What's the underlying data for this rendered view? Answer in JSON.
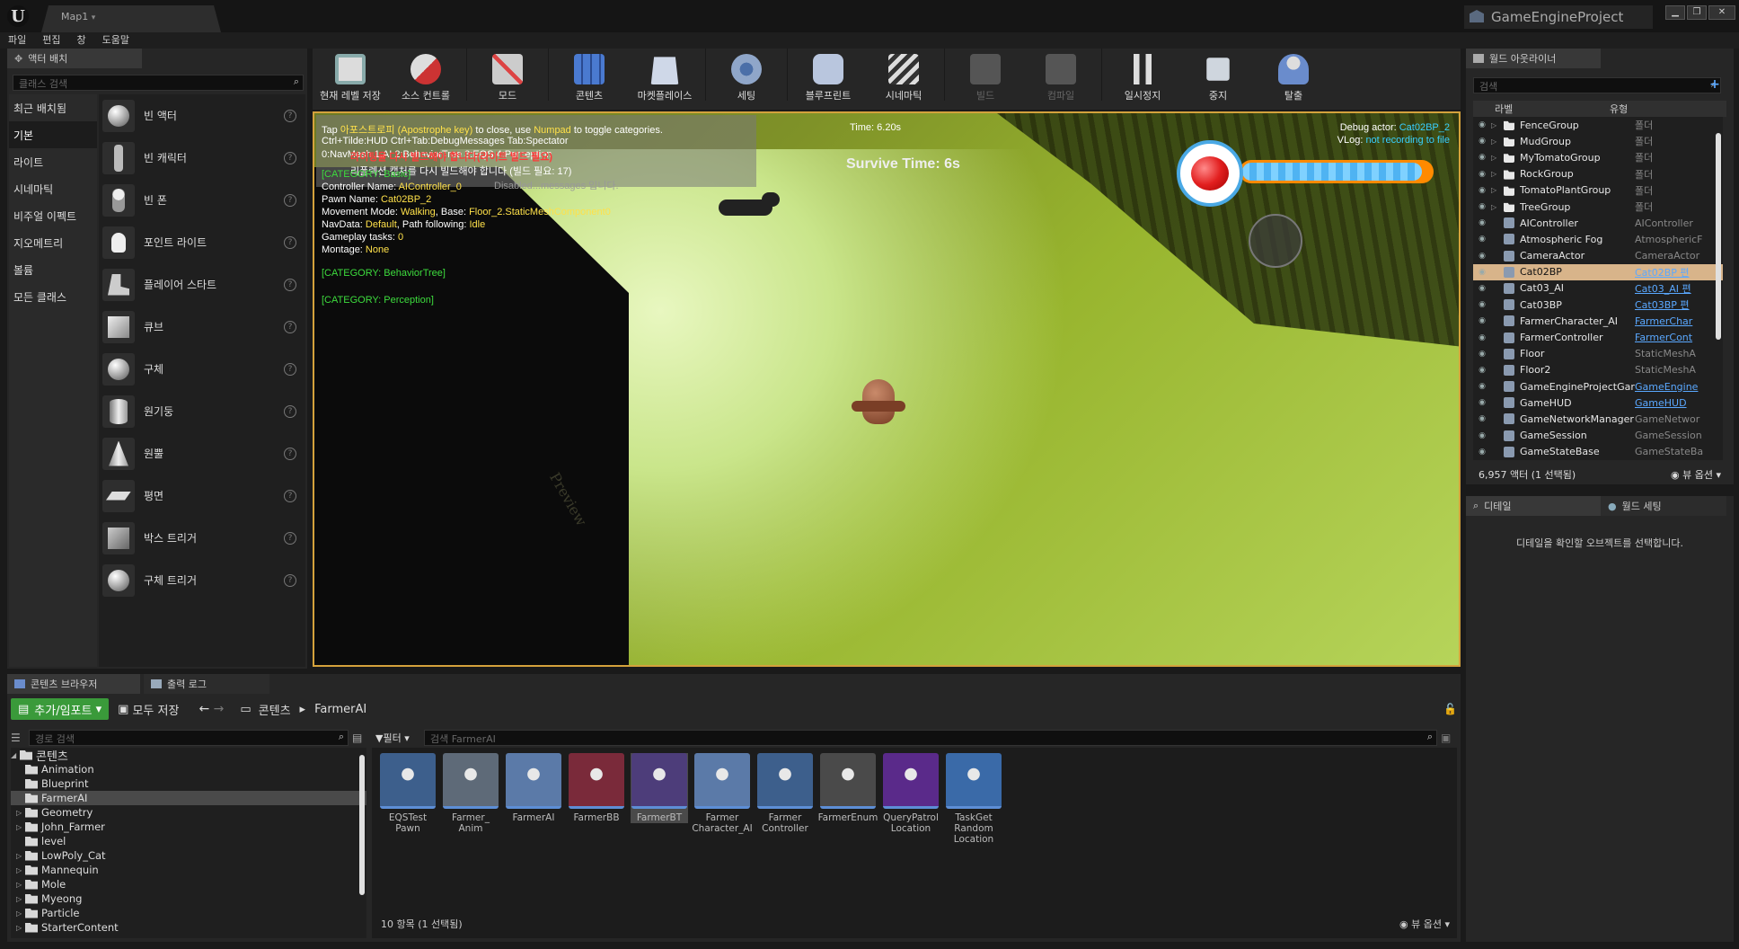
{
  "titlebar": {
    "logo": "U",
    "map_tab": "Map1",
    "project": "GameEngineProject",
    "buttons": [
      "▁",
      "❐",
      "✕"
    ]
  },
  "menu": [
    "파일",
    "편집",
    "창",
    "도움말"
  ],
  "place_actors": {
    "tab": "액터 배치",
    "search_placeholder": "클래스 검색",
    "categories": [
      "최근 배치됨",
      "기본",
      "라이트",
      "시네마틱",
      "비주얼 이펙트",
      "지오메트리",
      "볼륨",
      "모든 클래스"
    ],
    "active_category": 1,
    "items": [
      "빈 액터",
      "빈 캐릭터",
      "빈 폰",
      "포인트 라이트",
      "플레이어 스타트",
      "큐브",
      "구체",
      "원기둥",
      "원뿔",
      "평면",
      "박스 트리거",
      "구체 트리거"
    ]
  },
  "toolbar": {
    "tools": [
      {
        "label": "현재 레벨 저장",
        "icon": "save-icon"
      },
      {
        "label": "소스 컨트롤",
        "icon": "source-control-icon"
      },
      {
        "label": "모드",
        "icon": "modes-icon"
      },
      {
        "label": "콘텐츠",
        "icon": "content-icon"
      },
      {
        "label": "마켓플레이스",
        "icon": "marketplace-icon"
      },
      {
        "label": "세팅",
        "icon": "settings-icon"
      },
      {
        "label": "블루프린트",
        "icon": "blueprint-icon"
      },
      {
        "label": "시네마틱",
        "icon": "cinematics-icon"
      },
      {
        "label": "빌드",
        "icon": "build-icon"
      },
      {
        "label": "컴파일",
        "icon": "compile-icon"
      },
      {
        "label": "일시정지",
        "icon": "pause-icon"
      },
      {
        "label": "중지",
        "icon": "stop-icon"
      },
      {
        "label": "탈출",
        "icon": "eject-icon"
      }
    ]
  },
  "viewport": {
    "debug": {
      "l1a": "Tap ",
      "l1b": "아포스트로피 (Apostrophe key)",
      "l1c": " to close, use ",
      "l1d": "Numpad",
      "l1e": " to toggle categories.",
      "l2": "Ctrl+Tilde:HUD  Ctrl+Tab:DebugMessages  Tab:Spectator",
      "l3": "0:NavMesh 1:AI 2:BehaviorTree 3:EQS 4:Perception",
      "warn1": "라이팅을 다시 빌드해야 합니다(라이트 빌드 필요)",
      "warn2": "리플렉션 캡처를 다시 빌드해야 합니다 (빌드 필요: 17)",
      "disabled": "Disabled...messages 입니다.",
      "category_basic": "[CATEGORY: Basic]",
      "controller_label": "Controller Name: ",
      "controller_value": "AIController_0",
      "pawn_label": "Pawn Name: ",
      "pawn_value": "Cat02BP_2",
      "movement_label": "Movement Mode: ",
      "movement_value": "Walking",
      "base_label": ", Base: ",
      "base_value": "Floor_2.StaticMeshComponent0",
      "nav_label": "NavData: ",
      "nav_value": "Default",
      "path_label": ", Path following: ",
      "path_value": "Idle",
      "gameplay_label": "Gameplay tasks: ",
      "gameplay_value": "0",
      "montage_label": "Montage: ",
      "montage_value": "None",
      "category_bt": "[CATEGORY: BehaviorTree]",
      "category_perception": "[CATEGORY: Perception]",
      "time": "Time: 6.20s",
      "debug_actor_label": "Debug actor: ",
      "debug_actor_value": "Cat02BP_2",
      "vlog_label": "VLog: ",
      "vlog_value": "not recording to file"
    },
    "survive_time": "Survive Time: 6s",
    "health_fraction": 0.95,
    "watermark": "Preview"
  },
  "outliner": {
    "tab": "월드 아웃라이너",
    "search_placeholder": "검색",
    "col_label": "라벨",
    "col_type": "유형",
    "rows": [
      {
        "name": "FenceGroup",
        "type": "폴더",
        "kind": "folder"
      },
      {
        "name": "MudGroup",
        "type": "폴더",
        "kind": "folder"
      },
      {
        "name": "MyTomatoGroup",
        "type": "폴더",
        "kind": "folder"
      },
      {
        "name": "RockGroup",
        "type": "폴더",
        "kind": "folder"
      },
      {
        "name": "TomatoPlantGroup",
        "type": "폴더",
        "kind": "folder"
      },
      {
        "name": "TreeGroup",
        "type": "폴더",
        "kind": "folder"
      },
      {
        "name": "AIController",
        "type": "AIController",
        "kind": "actor"
      },
      {
        "name": "Atmospheric Fog",
        "type": "AtmosphericF",
        "kind": "actor"
      },
      {
        "name": "CameraActor",
        "type": "CameraActor",
        "kind": "actor"
      },
      {
        "name": "Cat02BP",
        "type": "Cat02BP 편",
        "kind": "actor",
        "selected": true,
        "link": true
      },
      {
        "name": "Cat03_AI",
        "type": "Cat03_AI 편",
        "kind": "actor",
        "link": true
      },
      {
        "name": "Cat03BP",
        "type": "Cat03BP 편",
        "kind": "actor",
        "link": true
      },
      {
        "name": "FarmerCharacter_AI",
        "type": "FarmerChar",
        "kind": "actor",
        "link": true
      },
      {
        "name": "FarmerController",
        "type": "FarmerCont",
        "kind": "actor",
        "link": true
      },
      {
        "name": "Floor",
        "type": "StaticMeshA",
        "kind": "actor"
      },
      {
        "name": "Floor2",
        "type": "StaticMeshA",
        "kind": "actor"
      },
      {
        "name": "GameEngineProjectGar",
        "type": "GameEngine",
        "kind": "actor",
        "link": true
      },
      {
        "name": "GameHUD",
        "type": "GameHUD",
        "kind": "actor",
        "link": true
      },
      {
        "name": "GameNetworkManager",
        "type": "GameNetwor",
        "kind": "actor"
      },
      {
        "name": "GameSession",
        "type": "GameSession",
        "kind": "actor"
      },
      {
        "name": "GameStateBase",
        "type": "GameStateBa",
        "kind": "actor"
      }
    ],
    "footer": "6,957 액터 (1 선택됨)",
    "view_options": "뷰 옵션"
  },
  "details": {
    "tab_details": "디테일",
    "tab_world": "월드 세팅",
    "empty_message": "디테일을 확인할 오브젝트를 선택합니다."
  },
  "content_browser": {
    "tab": "콘텐츠 브라우저",
    "tab_output": "출력 로그",
    "add_import": "추가/임포트",
    "save_all": "모두 저장",
    "breadcrumb_root": "콘텐츠",
    "breadcrumb_current": "FarmerAI",
    "path_search_placeholder": "경로 검색",
    "filter": "필터",
    "asset_search_placeholder": "검색 FarmerAI",
    "tree": [
      {
        "label": "콘텐츠",
        "level": 0,
        "expanded": true
      },
      {
        "label": "Animation",
        "level": 1
      },
      {
        "label": "Blueprint",
        "level": 1
      },
      {
        "label": "FarmerAI",
        "level": 1,
        "selected": true
      },
      {
        "label": "Geometry",
        "level": 1,
        "children": true
      },
      {
        "label": "John_Farmer",
        "level": 1,
        "children": true
      },
      {
        "label": "level",
        "level": 1
      },
      {
        "label": "LowPoly_Cat",
        "level": 1,
        "children": true
      },
      {
        "label": "Mannequin",
        "level": 1,
        "children": true
      },
      {
        "label": "Mole",
        "level": 1,
        "children": true
      },
      {
        "label": "Myeong",
        "level": 1,
        "children": true
      },
      {
        "label": "Particle",
        "level": 1,
        "children": true
      },
      {
        "label": "StarterContent",
        "level": 1,
        "children": true
      }
    ],
    "assets": [
      {
        "label": "EQSTest Pawn",
        "color": "#3d5f8c"
      },
      {
        "label": "Farmer_ Anim",
        "color": "#5e6a78"
      },
      {
        "label": "FarmerAI",
        "color": "#5b7aa8"
      },
      {
        "label": "FarmerBB",
        "color": "#7a2a3a"
      },
      {
        "label": "FarmerBT",
        "color": "#4d3d7a",
        "selected": true
      },
      {
        "label": "Farmer Character_AI",
        "color": "#5b7aa8"
      },
      {
        "label": "Farmer Controller",
        "color": "#3d5f8c"
      },
      {
        "label": "FarmerEnum",
        "color": "#4a4a4a"
      },
      {
        "label": "QueryPatrol Location",
        "color": "#5a2a8a"
      },
      {
        "label": "TaskGet Random Location",
        "color": "#3a6aa8"
      }
    ],
    "footer": "10 항목 (1 선택됨)",
    "view_options": "뷰 옵션"
  }
}
